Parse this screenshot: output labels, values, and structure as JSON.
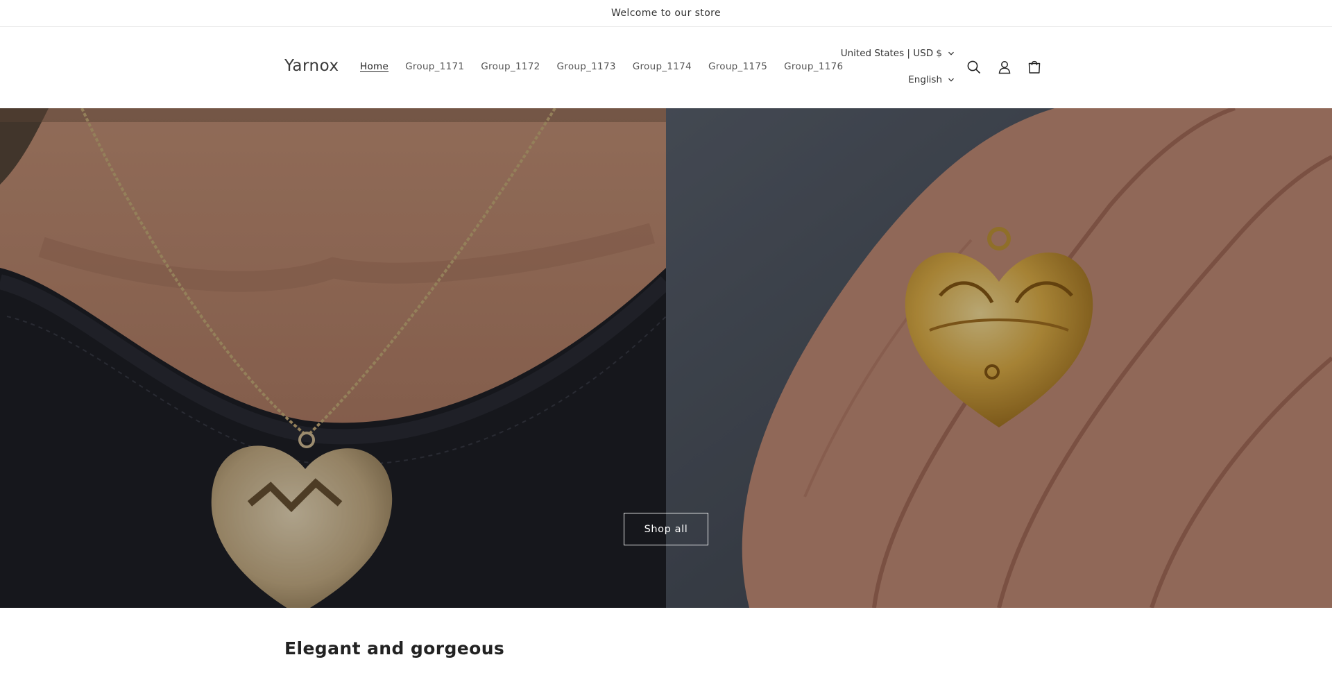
{
  "announcement": {
    "text": "Welcome to our store"
  },
  "header": {
    "logo": "Yarnox",
    "nav": [
      {
        "label": "Home",
        "active": true
      },
      {
        "label": "Group_1171",
        "active": false
      },
      {
        "label": "Group_1172",
        "active": false
      },
      {
        "label": "Group_1173",
        "active": false
      },
      {
        "label": "Group_1174",
        "active": false
      },
      {
        "label": "Group_1175",
        "active": false
      },
      {
        "label": "Group_1176",
        "active": false
      }
    ],
    "country_currency": "United States | USD $",
    "language": "English",
    "icons": [
      "search-icon",
      "account-icon",
      "cart-icon"
    ]
  },
  "hero": {
    "button_label": "Shop all",
    "left_image": "heart-locket-necklace-photo",
    "right_image": "gold-heart-pendant-in-hand-photo"
  },
  "featured": {
    "heading": "Elegant and gorgeous"
  },
  "colors": {
    "text": "#121212",
    "overlay": "rgba(0,0,0,0.28)",
    "button_border": "#ffffff"
  }
}
